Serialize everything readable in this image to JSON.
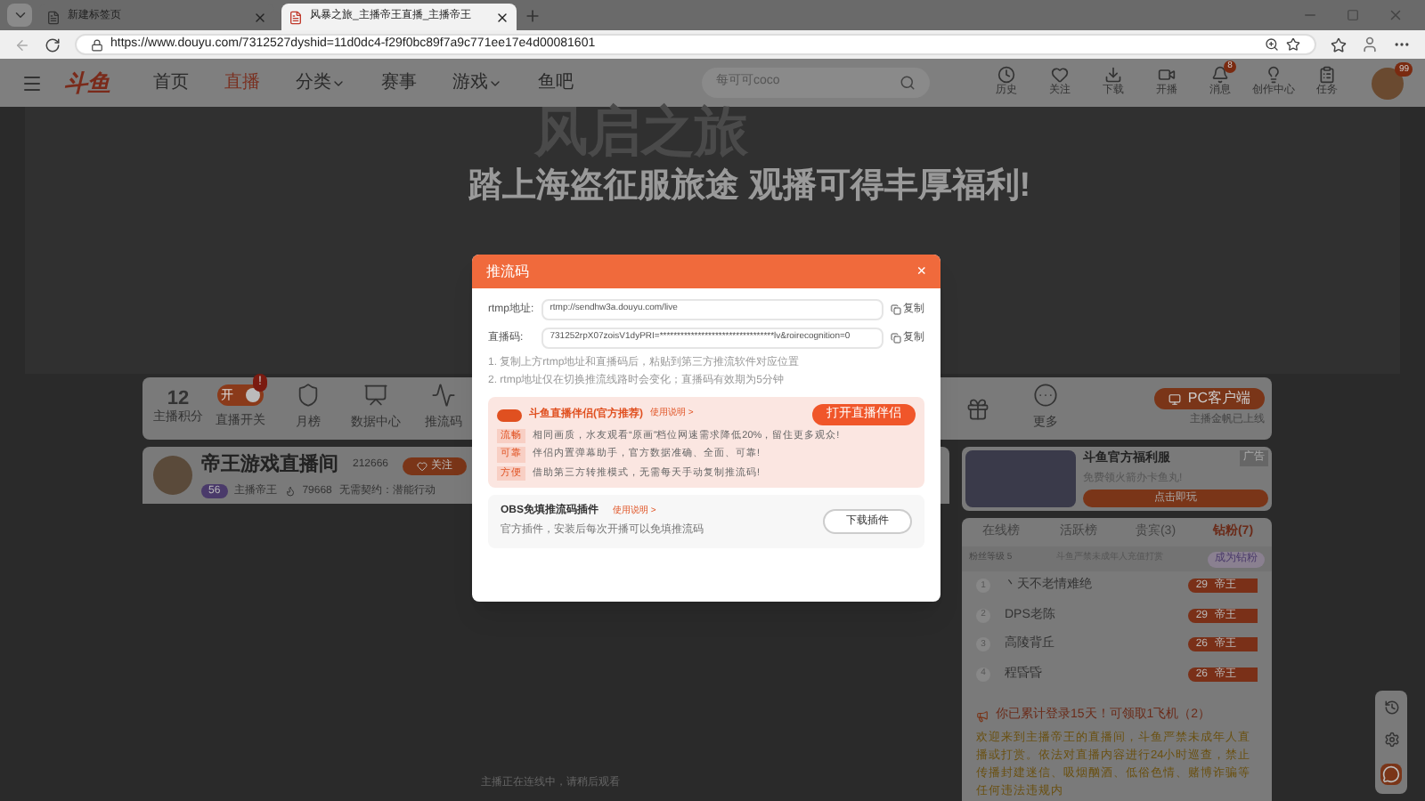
{
  "browser": {
    "tabs": [
      {
        "title": "新建标签页",
        "selected": false
      },
      {
        "title": "风暴之旅_主播帝王直播_主播帝王",
        "selected": true
      }
    ],
    "url": "https://www.douyu.com/7312527dyshid=11d0dc4-f29f0bc89f7a9c771ee17e4d00081601"
  },
  "site_header": {
    "logo": "斗鱼",
    "nav": [
      {
        "label": "首页",
        "selected": false,
        "dropdown": false
      },
      {
        "label": "直播",
        "selected": true,
        "dropdown": false
      },
      {
        "label": "分类",
        "selected": false,
        "dropdown": true
      },
      {
        "label": "赛事",
        "selected": false,
        "dropdown": false
      },
      {
        "label": "游戏",
        "selected": false,
        "dropdown": true
      },
      {
        "label": "鱼吧",
        "selected": false,
        "dropdown": false
      }
    ],
    "search": {
      "placeholder": "每可可coco"
    },
    "actions": [
      {
        "label": "历史"
      },
      {
        "label": "关注"
      },
      {
        "label": "下载"
      },
      {
        "label": "开播"
      },
      {
        "label": "消息",
        "badge": "8"
      },
      {
        "label": "创作中心"
      },
      {
        "label": "任务"
      }
    ],
    "avatar_badge": "99"
  },
  "banner": {
    "art_title": "风启之旅",
    "headline": "踏上海盗征服旅途 观播可得丰厚福利!"
  },
  "toolbar": {
    "score": "12",
    "score_label": "主播积分",
    "items": [
      {
        "kind": "toggle",
        "label": "直播开关",
        "on": true,
        "toggle_text": "开",
        "badge": "!"
      },
      {
        "kind": "icon",
        "label": "月榜"
      },
      {
        "kind": "icon",
        "label": "数据中心"
      },
      {
        "kind": "icon",
        "label": "推流码"
      },
      {
        "kind": "icon"
      },
      {
        "kind": "icon",
        "label": "更多"
      }
    ],
    "client_button": "PC客户端",
    "client_note": "主播金帆已上线"
  },
  "room": {
    "title": "帝王游戏直播间",
    "room_id": "212666",
    "follow": "关注",
    "level": "56",
    "anchor": "主播帝王",
    "hot": "79668",
    "contract": "无需契约：潜能行动"
  },
  "video": {
    "status": "主播正在连线中，请稍后观看"
  },
  "ad": {
    "title": "斗鱼官方福利服",
    "subtitle": "免费领火箭办卡鱼丸!",
    "tag": "广告",
    "button": "点击即玩"
  },
  "rank": {
    "tabs": [
      {
        "label": "在线榜",
        "selected": false
      },
      {
        "label": "活跃榜",
        "selected": false
      },
      {
        "label": "贵宾(3)",
        "selected": false
      },
      {
        "label": "钻粉(7)",
        "selected": true
      }
    ],
    "fan_level": "粉丝等级 5",
    "notice": "斗鱼严禁未成年人充值打赏",
    "join": "成为钻粉",
    "rows": [
      {
        "rank": "1",
        "name": "丶天不老情难绝",
        "level": "29",
        "title": "帝王"
      },
      {
        "rank": "2",
        "name": "DPS老陈",
        "level": "29",
        "title": "帝王"
      },
      {
        "rank": "3",
        "name": "高陵背丘",
        "level": "26",
        "title": "帝王"
      },
      {
        "rank": "4",
        "name": "程昏昏",
        "level": "26",
        "title": "帝王"
      }
    ]
  },
  "chat": {
    "login_notice": "你已累计登录15天！可领取1飞机（2）",
    "welcome": "欢迎来到主播帝王的直播间，斗鱼严禁未成年人直播或打赏。依法对直播内容进行24小时巡查，禁止传播封建迷信、吸烟酗酒、低俗色情、赌博诈骗等任何违法违规内"
  },
  "dialog": {
    "title": "推流码",
    "close": "×",
    "fields": [
      {
        "label": "rtmp地址:",
        "value": "rtmp://sendhw3a.douyu.com/live",
        "copy": "复制"
      },
      {
        "label": "直播码:",
        "value": "731252rpX07zoisV1dyPRI=*********************************lv&roirecognition=0",
        "copy": "复制"
      }
    ],
    "notes": [
      "1. 复制上方rtmp地址和直播码后，粘贴到第三方推流软件对应位置",
      "2. rtmp地址仅在切换推流线路时会变化；直播码有效期为5分钟"
    ],
    "companion": {
      "title": "斗鱼直播伴侣(官方推荐)",
      "help": "使用说明 >",
      "button": "打开直播伴侣",
      "features": [
        {
          "tag": "流畅",
          "text": "相同画质，水友观看“原画”档位网速需求降低20%，留住更多观众!"
        },
        {
          "tag": "可靠",
          "text": "伴侣内置弹幕助手，官方数据准确、全面、可靠!"
        },
        {
          "tag": "方便",
          "text": "借助第三方转推模式，无需每天手动复制推流码!"
        }
      ]
    },
    "plugin": {
      "title": "OBS免填推流码插件",
      "help": "使用说明 >",
      "desc": "官方插件，安装后每次开播可以免填推流码",
      "button": "下载插件"
    }
  }
}
